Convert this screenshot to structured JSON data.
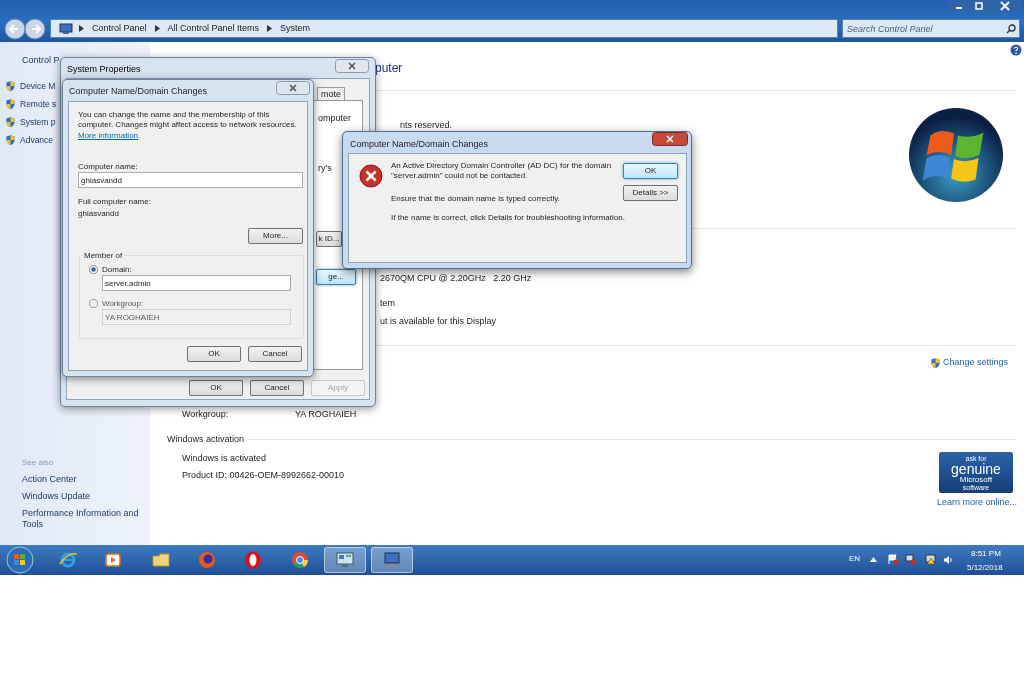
{
  "window": {
    "breadcrumb": [
      "Control Panel",
      "All Control Panel Items",
      "System"
    ],
    "search": {
      "placeholder": "Search Control Panel"
    }
  },
  "sidebar": {
    "home": "Control P",
    "tasks": [
      "Device M",
      "Remote s",
      "System p",
      "Advance"
    ],
    "see_also": {
      "heading": "See also",
      "links": [
        "Action Center",
        "Windows Update",
        "Performance Information and Tools"
      ]
    }
  },
  "main": {
    "heading": "puter",
    "copyright": "nts reserved.",
    "processor": "2670QM CPU @ 2.20GHz   2.20 GHz",
    "system_type": "tem",
    "pen_touch": "ut is available for this Display",
    "change_settings": "Change settings",
    "workgroup": {
      "label": "Workgroup:",
      "value": "YA ROGHAIEH"
    },
    "activation": {
      "heading": "Windows activation",
      "status": "Windows is activated",
      "product_id": "Product ID: 00426-OEM-8992662-00010"
    },
    "genuine": {
      "lines": [
        "ask for",
        "genuine",
        "Microsoft",
        "software"
      ],
      "link": "Learn more online..."
    }
  },
  "system_properties": {
    "title": "System Properties",
    "tab": "mote",
    "fragments": [
      "omputer",
      "ry's"
    ],
    "buttons": [
      {
        "label": "k ID...",
        "focused": false
      },
      {
        "label": "ge...",
        "focused": true
      }
    ],
    "footer_buttons": [
      {
        "label": "OK",
        "disabled": false
      },
      {
        "label": "Cancel",
        "disabled": false
      },
      {
        "label": "Apply",
        "disabled": true
      }
    ]
  },
  "name_dialog": {
    "title": "Computer Name/Domain Changes",
    "intro": "You can change the name and the membership of this computer. Changes might affect access to network resources.",
    "link": "More information",
    "computer_name": {
      "label": "Computer name:",
      "value": "ghiasvandd"
    },
    "full_name": {
      "label": "Full computer name:",
      "value": "ghiasvandd"
    },
    "more_button": "More...",
    "member_of": {
      "legend": "Member of",
      "options": [
        {
          "label": "Domain:",
          "selected": true,
          "value": "server.admin"
        },
        {
          "label": "Workgroup:",
          "selected": false,
          "value": "YA ROGHAIEH"
        }
      ]
    },
    "buttons": [
      "OK",
      "Cancel"
    ]
  },
  "error_dialog": {
    "title": "Computer Name/Domain Changes",
    "messages": [
      "An Active Directory Domain Controller (AD DC) for the domain \"server.admin\" could not be contacted.",
      "Ensure that the domain name is typed correctly.",
      "If the name is correct, click Details for troubleshooting information."
    ],
    "buttons": [
      {
        "label": "OK",
        "default": true
      },
      {
        "label": "Details >>",
        "default": false
      }
    ]
  },
  "taskbar": {
    "apps": [
      {
        "kind": "ie",
        "open": false
      },
      {
        "kind": "media",
        "open": false
      },
      {
        "kind": "folder",
        "open": false
      },
      {
        "kind": "firefox",
        "open": false
      },
      {
        "kind": "opera",
        "open": false
      },
      {
        "kind": "chrome",
        "open": false
      },
      {
        "kind": "control",
        "open": true
      },
      {
        "kind": "system",
        "open": true
      }
    ],
    "language": "EN",
    "time": "8:51 PM",
    "date": "5/12/2018"
  }
}
